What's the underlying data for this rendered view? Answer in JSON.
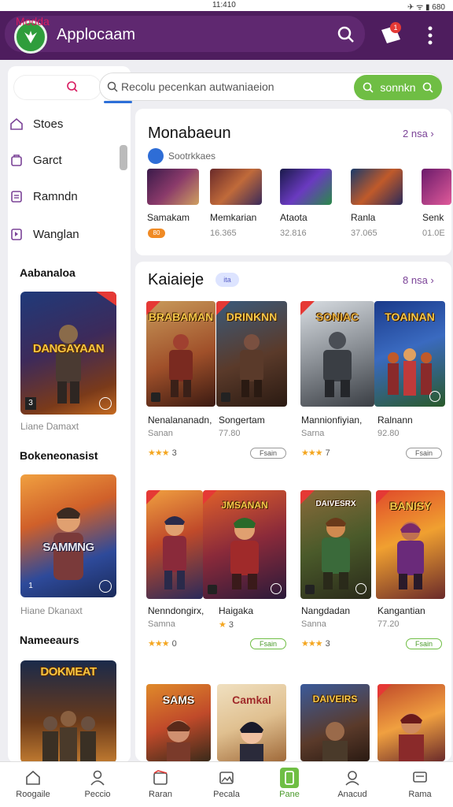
{
  "status_bar": {
    "time": "11:410",
    "icons": "✈ ᯤ ▮ 680"
  },
  "header": {
    "app_name": "Applocaam",
    "notification_count": "1"
  },
  "search": {
    "placeholder": "Recolu pecenkan autwaniaeion",
    "button_label": "sonnkn",
    "tab_label": "Modda"
  },
  "sidebar": {
    "items": [
      {
        "label": "Stoes",
        "icon": "home-icon"
      },
      {
        "label": "Garct",
        "icon": "bag-icon"
      },
      {
        "label": "Ramndn",
        "icon": "list-icon"
      },
      {
        "label": "Wanglan",
        "icon": "book-icon"
      }
    ],
    "sections": [
      {
        "title": "Aabanaloa",
        "card_title": "DANGAYAAN",
        "caption": "Liane Damaxt",
        "badge": "3"
      },
      {
        "title": "Bokeneonasist",
        "card_title": "SAMMNG",
        "caption": "Hiane Dkanaxt",
        "badge": "1"
      },
      {
        "title": "Nameeaurs",
        "card_title": "DOKMEAT",
        "caption": "",
        "badge": ""
      }
    ]
  },
  "section_featured": {
    "title": "Monabaeun",
    "link": "2 nsa",
    "subtitle": "Sootrkkaes",
    "items": [
      {
        "name": "Samakam",
        "meta": "",
        "badge": "80"
      },
      {
        "name": "Memkarian",
        "meta": "16.365"
      },
      {
        "name": "Ataota",
        "meta": "32.816"
      },
      {
        "name": "Ranla",
        "meta": "37.065"
      },
      {
        "name": "Senk",
        "meta": "01.0E"
      }
    ]
  },
  "section_games": {
    "title": "Kaiaieje",
    "pill": "ita",
    "link": "8 nsa",
    "games": [
      {
        "art_title": "BRABAMAN",
        "name": "Nenalananadn,",
        "sub": "Sanan",
        "rating_stars": "★★★",
        "rating": "3",
        "install": "Fsain"
      },
      {
        "art_title": "DRINKNN",
        "name": "Songertam",
        "sub": "77.80",
        "rating_stars": "",
        "rating": "",
        "install": ""
      },
      {
        "art_title": "SONIAC",
        "name": "Mannionfiyian,",
        "sub": "Sarna",
        "rating_stars": "★★★",
        "rating": "7",
        "install": "Fsain"
      },
      {
        "art_title": "TOAINAN",
        "name": "Ralnann",
        "sub": "92.80",
        "rating_stars": "",
        "rating": "",
        "install": "Fsain"
      },
      {
        "art_title": "",
        "name": "Nenndongirx,",
        "sub": "Samna",
        "rating_stars": "★★★",
        "rating": "0",
        "install": "Fsain"
      },
      {
        "art_title": "JMSANAN",
        "name": "Haigaka",
        "sub": "",
        "rating_stars": "★",
        "rating": "3",
        "install": ""
      },
      {
        "art_title": "DAIVESRX",
        "name": "Nangdadan",
        "sub": "Sanna",
        "rating_stars": "★★★",
        "rating": "3",
        "install": "Fsain"
      },
      {
        "art_title": "BANISY",
        "name": "Kangantian",
        "sub": "77.20",
        "rating_stars": "",
        "rating": "",
        "install": "Fsain"
      },
      {
        "art_title": "SAMS",
        "name": "",
        "sub": "",
        "rating_stars": "",
        "rating": "",
        "install": ""
      },
      {
        "art_title": "Camkal",
        "name": "",
        "sub": "",
        "rating_stars": "",
        "rating": "",
        "install": ""
      },
      {
        "art_title": "DAIVEIRS",
        "name": "",
        "sub": "",
        "rating_stars": "",
        "rating": "",
        "install": ""
      },
      {
        "art_title": "",
        "name": "",
        "sub": "",
        "rating_stars": "",
        "rating": "",
        "install": ""
      }
    ]
  },
  "bottom_nav": [
    {
      "label": "Roogaile",
      "icon": "home-icon"
    },
    {
      "label": "Peccio",
      "icon": "person-icon"
    },
    {
      "label": "Raran",
      "icon": "store-icon"
    },
    {
      "label": "Pecala",
      "icon": "image-icon"
    },
    {
      "label": "Pane",
      "icon": "phone-icon",
      "active": true
    },
    {
      "label": "Anacud",
      "icon": "user-icon"
    },
    {
      "label": "Rama",
      "icon": "chat-icon"
    }
  ],
  "colors": {
    "header": "#4e1d5e",
    "accent_green": "#6fbe44",
    "accent_pink": "#d81b60",
    "accent_purple": "#7b4397"
  }
}
